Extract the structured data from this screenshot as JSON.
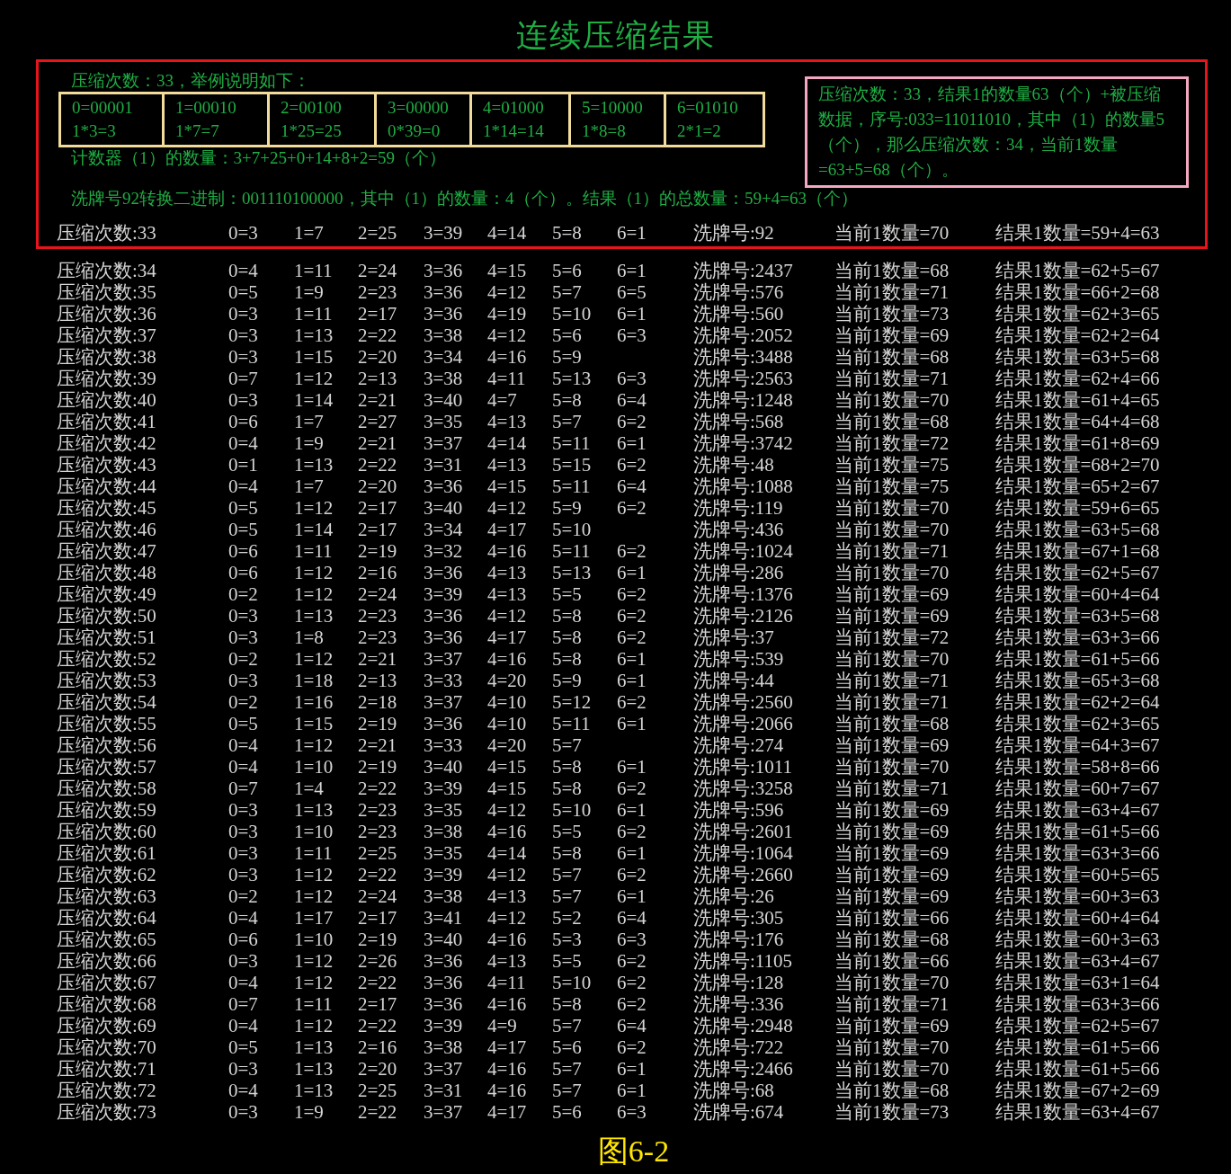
{
  "title": "连续压缩结果",
  "example": {
    "intro": "压缩次数：33，举例说明如下：",
    "table": [
      {
        "code": "0=00001",
        "product": "1*3=3"
      },
      {
        "code": "1=00010",
        "product": "1*7=7"
      },
      {
        "code": "2=00100",
        "product": "1*25=25"
      },
      {
        "code": "3=00000",
        "product": "0*39=0"
      },
      {
        "code": "4=01000",
        "product": "1*14=14"
      },
      {
        "code": "5=10000",
        "product": "1*8=8"
      },
      {
        "code": "6=01010",
        "product": "2*1=2"
      }
    ],
    "counter_line": "计数器（1）的数量：3+7+25+0+14+8+2=59（个）",
    "note": "压缩次数：33，结果1的数量63（个）+被压缩数据，序号:033=11011010，其中（1）的数量5（个），那么压缩次数：34，当前1数量=63+5=68（个）。",
    "binary_line": "洗牌号92转换二进制：001110100000，其中（1）的数量：4（个）。结果（1）的总数量：59+4=63（个）",
    "row": {
      "label": "压缩次数:33",
      "bins": [
        "0=3",
        "1=7",
        "2=25",
        "3=39",
        "4=14",
        "5=8",
        "6=1"
      ],
      "shuffle": "洗牌号:92",
      "current": "当前1数量=70",
      "result": "结果1数量=59+4=63"
    }
  },
  "rows": [
    {
      "label": "压缩次数:34",
      "bins": [
        "0=4",
        "1=11",
        "2=24",
        "3=36",
        "4=15",
        "5=6",
        "6=1"
      ],
      "shuffle": "洗牌号:2437",
      "current": "当前1数量=68",
      "result": "结果1数量=62+5=67"
    },
    {
      "label": "压缩次数:35",
      "bins": [
        "0=5",
        "1=9",
        "2=23",
        "3=36",
        "4=12",
        "5=7",
        "6=5"
      ],
      "shuffle": "洗牌号:576",
      "current": "当前1数量=71",
      "result": "结果1数量=66+2=68"
    },
    {
      "label": "压缩次数:36",
      "bins": [
        "0=3",
        "1=11",
        "2=17",
        "3=36",
        "4=19",
        "5=10",
        "6=1"
      ],
      "shuffle": "洗牌号:560",
      "current": "当前1数量=73",
      "result": "结果1数量=62+3=65"
    },
    {
      "label": "压缩次数:37",
      "bins": [
        "0=3",
        "1=13",
        "2=22",
        "3=38",
        "4=12",
        "5=6",
        "6=3"
      ],
      "shuffle": "洗牌号:2052",
      "current": "当前1数量=69",
      "result": "结果1数量=62+2=64"
    },
    {
      "label": "压缩次数:38",
      "bins": [
        "0=3",
        "1=15",
        "2=20",
        "3=34",
        "4=16",
        "5=9"
      ],
      "shuffle": "洗牌号:3488",
      "current": "当前1数量=68",
      "result": "结果1数量=63+5=68"
    },
    {
      "label": "压缩次数:39",
      "bins": [
        "0=7",
        "1=12",
        "2=13",
        "3=38",
        "4=11",
        "5=13",
        "6=3"
      ],
      "shuffle": "洗牌号:2563",
      "current": "当前1数量=71",
      "result": "结果1数量=62+4=66"
    },
    {
      "label": "压缩次数:40",
      "bins": [
        "0=3",
        "1=14",
        "2=21",
        "3=40",
        "4=7",
        "5=8",
        "6=4"
      ],
      "shuffle": "洗牌号:1248",
      "current": "当前1数量=70",
      "result": "结果1数量=61+4=65"
    },
    {
      "label": "压缩次数:41",
      "bins": [
        "0=6",
        "1=7",
        "2=27",
        "3=35",
        "4=13",
        "5=7",
        "6=2"
      ],
      "shuffle": "洗牌号:568",
      "current": "当前1数量=68",
      "result": "结果1数量=64+4=68"
    },
    {
      "label": "压缩次数:42",
      "bins": [
        "0=4",
        "1=9",
        "2=21",
        "3=37",
        "4=14",
        "5=11",
        "6=1"
      ],
      "shuffle": "洗牌号:3742",
      "current": "当前1数量=72",
      "result": "结果1数量=61+8=69"
    },
    {
      "label": "压缩次数:43",
      "bins": [
        "0=1",
        "1=13",
        "2=22",
        "3=31",
        "4=13",
        "5=15",
        "6=2"
      ],
      "shuffle": "洗牌号:48",
      "current": "当前1数量=75",
      "result": "结果1数量=68+2=70"
    },
    {
      "label": "压缩次数:44",
      "bins": [
        "0=4",
        "1=7",
        "2=20",
        "3=36",
        "4=15",
        "5=11",
        "6=4"
      ],
      "shuffle": "洗牌号:1088",
      "current": "当前1数量=75",
      "result": "结果1数量=65+2=67"
    },
    {
      "label": "压缩次数:45",
      "bins": [
        "0=5",
        "1=12",
        "2=17",
        "3=40",
        "4=12",
        "5=9",
        "6=2"
      ],
      "shuffle": "洗牌号:119",
      "current": "当前1数量=70",
      "result": "结果1数量=59+6=65"
    },
    {
      "label": "压缩次数:46",
      "bins": [
        "0=5",
        "1=14",
        "2=17",
        "3=34",
        "4=17",
        "5=10"
      ],
      "shuffle": "洗牌号:436",
      "current": "当前1数量=70",
      "result": "结果1数量=63+5=68"
    },
    {
      "label": "压缩次数:47",
      "bins": [
        "0=6",
        "1=11",
        "2=19",
        "3=32",
        "4=16",
        "5=11",
        "6=2"
      ],
      "shuffle": "洗牌号:1024",
      "current": "当前1数量=71",
      "result": "结果1数量=67+1=68"
    },
    {
      "label": "压缩次数:48",
      "bins": [
        "0=6",
        "1=12",
        "2=16",
        "3=36",
        "4=13",
        "5=13",
        "6=1"
      ],
      "shuffle": "洗牌号:286",
      "current": "当前1数量=70",
      "result": "结果1数量=62+5=67"
    },
    {
      "label": "压缩次数:49",
      "bins": [
        "0=2",
        "1=12",
        "2=24",
        "3=39",
        "4=13",
        "5=5",
        "6=2"
      ],
      "shuffle": "洗牌号:1376",
      "current": "当前1数量=69",
      "result": "结果1数量=60+4=64"
    },
    {
      "label": "压缩次数:50",
      "bins": [
        "0=3",
        "1=13",
        "2=23",
        "3=36",
        "4=12",
        "5=8",
        "6=2"
      ],
      "shuffle": "洗牌号:2126",
      "current": "当前1数量=69",
      "result": "结果1数量=63+5=68"
    },
    {
      "label": "压缩次数:51",
      "bins": [
        "0=3",
        "1=8",
        "2=23",
        "3=36",
        "4=17",
        "5=8",
        "6=2"
      ],
      "shuffle": "洗牌号:37",
      "current": "当前1数量=72",
      "result": "结果1数量=63+3=66"
    },
    {
      "label": "压缩次数:52",
      "bins": [
        "0=2",
        "1=12",
        "2=21",
        "3=37",
        "4=16",
        "5=8",
        "6=1"
      ],
      "shuffle": "洗牌号:539",
      "current": "当前1数量=70",
      "result": "结果1数量=61+5=66"
    },
    {
      "label": "压缩次数:53",
      "bins": [
        "0=3",
        "1=18",
        "2=13",
        "3=33",
        "4=20",
        "5=9",
        "6=1"
      ],
      "shuffle": "洗牌号:44",
      "current": "当前1数量=71",
      "result": "结果1数量=65+3=68"
    },
    {
      "label": "压缩次数:54",
      "bins": [
        "0=2",
        "1=16",
        "2=18",
        "3=37",
        "4=10",
        "5=12",
        "6=2"
      ],
      "shuffle": "洗牌号:2560",
      "current": "当前1数量=71",
      "result": "结果1数量=62+2=64"
    },
    {
      "label": "压缩次数:55",
      "bins": [
        "0=5",
        "1=15",
        "2=19",
        "3=36",
        "4=10",
        "5=11",
        "6=1"
      ],
      "shuffle": "洗牌号:2066",
      "current": "当前1数量=68",
      "result": "结果1数量=62+3=65"
    },
    {
      "label": "压缩次数:56",
      "bins": [
        "0=4",
        "1=12",
        "2=21",
        "3=33",
        "4=20",
        "5=7"
      ],
      "shuffle": "洗牌号:274",
      "current": "当前1数量=69",
      "result": "结果1数量=64+3=67"
    },
    {
      "label": "压缩次数:57",
      "bins": [
        "0=4",
        "1=10",
        "2=19",
        "3=40",
        "4=15",
        "5=8",
        "6=1"
      ],
      "shuffle": "洗牌号:1011",
      "current": "当前1数量=70",
      "result": "结果1数量=58+8=66"
    },
    {
      "label": "压缩次数:58",
      "bins": [
        "0=7",
        "1=4",
        "2=22",
        "3=39",
        "4=15",
        "5=8",
        "6=2"
      ],
      "shuffle": "洗牌号:3258",
      "current": "当前1数量=71",
      "result": "结果1数量=60+7=67"
    },
    {
      "label": "压缩次数:59",
      "bins": [
        "0=3",
        "1=13",
        "2=23",
        "3=35",
        "4=12",
        "5=10",
        "6=1"
      ],
      "shuffle": "洗牌号:596",
      "current": "当前1数量=69",
      "result": "结果1数量=63+4=67"
    },
    {
      "label": "压缩次数:60",
      "bins": [
        "0=3",
        "1=10",
        "2=23",
        "3=38",
        "4=16",
        "5=5",
        "6=2"
      ],
      "shuffle": "洗牌号:2601",
      "current": "当前1数量=69",
      "result": "结果1数量=61+5=66"
    },
    {
      "label": "压缩次数:61",
      "bins": [
        "0=3",
        "1=11",
        "2=25",
        "3=35",
        "4=14",
        "5=8",
        "6=1"
      ],
      "shuffle": "洗牌号:1064",
      "current": "当前1数量=69",
      "result": "结果1数量=63+3=66"
    },
    {
      "label": "压缩次数:62",
      "bins": [
        "0=3",
        "1=12",
        "2=22",
        "3=39",
        "4=12",
        "5=7",
        "6=2"
      ],
      "shuffle": "洗牌号:2660",
      "current": "当前1数量=69",
      "result": "结果1数量=60+5=65"
    },
    {
      "label": "压缩次数:63",
      "bins": [
        "0=2",
        "1=12",
        "2=24",
        "3=38",
        "4=13",
        "5=7",
        "6=1"
      ],
      "shuffle": "洗牌号:26",
      "current": "当前1数量=69",
      "result": "结果1数量=60+3=63"
    },
    {
      "label": "压缩次数:64",
      "bins": [
        "0=4",
        "1=17",
        "2=17",
        "3=41",
        "4=12",
        "5=2",
        "6=4"
      ],
      "shuffle": "洗牌号:305",
      "current": "当前1数量=66",
      "result": "结果1数量=60+4=64"
    },
    {
      "label": "压缩次数:65",
      "bins": [
        "0=6",
        "1=10",
        "2=19",
        "3=40",
        "4=16",
        "5=3",
        "6=3"
      ],
      "shuffle": "洗牌号:176",
      "current": "当前1数量=68",
      "result": "结果1数量=60+3=63"
    },
    {
      "label": "压缩次数:66",
      "bins": [
        "0=3",
        "1=12",
        "2=26",
        "3=36",
        "4=13",
        "5=5",
        "6=2"
      ],
      "shuffle": "洗牌号:1105",
      "current": "当前1数量=66",
      "result": "结果1数量=63+4=67"
    },
    {
      "label": "压缩次数:67",
      "bins": [
        "0=4",
        "1=12",
        "2=22",
        "3=36",
        "4=11",
        "5=10",
        "6=2"
      ],
      "shuffle": "洗牌号:128",
      "current": "当前1数量=70",
      "result": "结果1数量=63+1=64"
    },
    {
      "label": "压缩次数:68",
      "bins": [
        "0=7",
        "1=11",
        "2=17",
        "3=36",
        "4=16",
        "5=8",
        "6=2"
      ],
      "shuffle": "洗牌号:336",
      "current": "当前1数量=71",
      "result": "结果1数量=63+3=66"
    },
    {
      "label": "压缩次数:69",
      "bins": [
        "0=4",
        "1=12",
        "2=22",
        "3=39",
        "4=9",
        "5=7",
        "6=4"
      ],
      "shuffle": "洗牌号:2948",
      "current": "当前1数量=69",
      "result": "结果1数量=62+5=67"
    },
    {
      "label": "压缩次数:70",
      "bins": [
        "0=5",
        "1=13",
        "2=16",
        "3=38",
        "4=17",
        "5=6",
        "6=2"
      ],
      "shuffle": "洗牌号:722",
      "current": "当前1数量=70",
      "result": "结果1数量=61+5=66"
    },
    {
      "label": "压缩次数:71",
      "bins": [
        "0=3",
        "1=13",
        "2=20",
        "3=37",
        "4=16",
        "5=7",
        "6=1"
      ],
      "shuffle": "洗牌号:2466",
      "current": "当前1数量=70",
      "result": "结果1数量=61+5=66"
    },
    {
      "label": "压缩次数:72",
      "bins": [
        "0=4",
        "1=13",
        "2=25",
        "3=31",
        "4=16",
        "5=7",
        "6=1"
      ],
      "shuffle": "洗牌号:68",
      "current": "当前1数量=68",
      "result": "结果1数量=67+2=69"
    },
    {
      "label": "压缩次数:73",
      "bins": [
        "0=3",
        "1=9",
        "2=22",
        "3=37",
        "4=17",
        "5=6",
        "6=3"
      ],
      "shuffle": "洗牌号:674",
      "current": "当前1数量=73",
      "result": "结果1数量=63+4=67"
    }
  ],
  "caption": "图6-2"
}
